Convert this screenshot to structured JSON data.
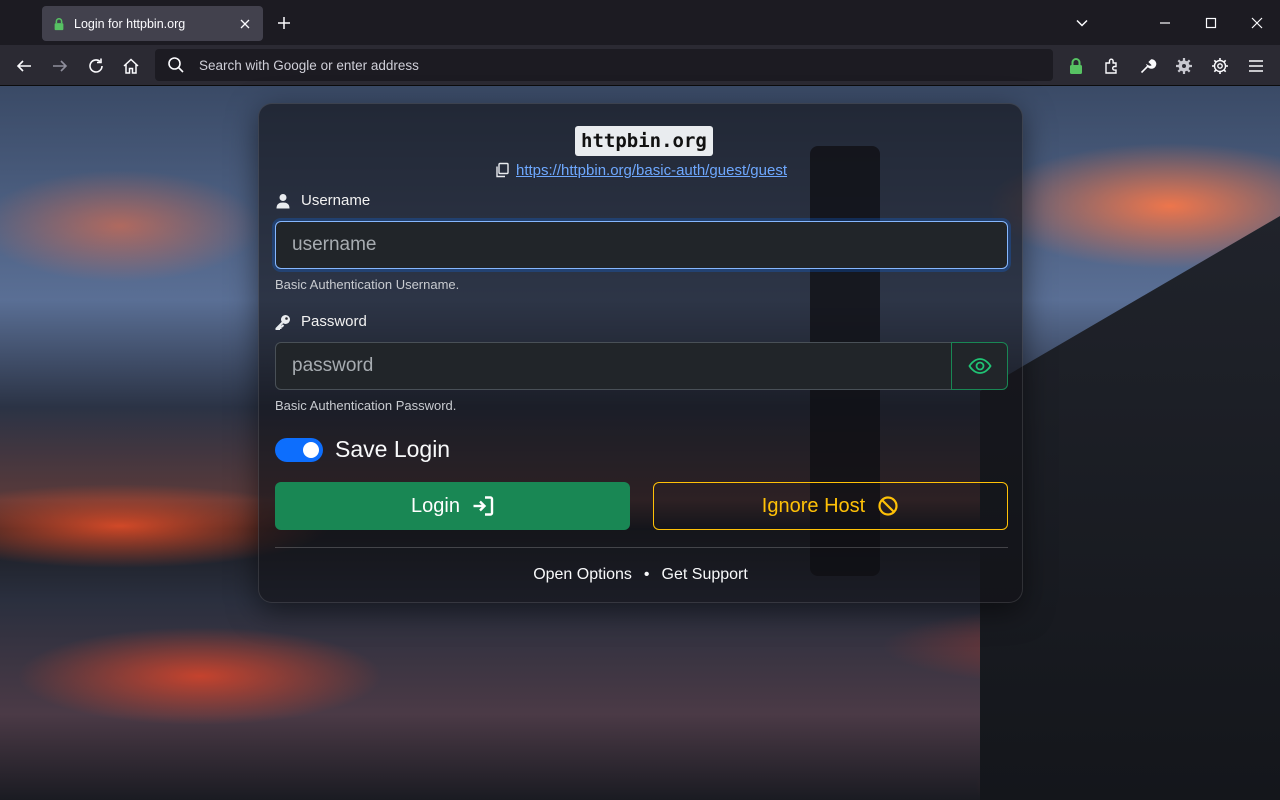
{
  "browser": {
    "tab_title": "Login for httpbin.org",
    "url_placeholder": "Search with Google or enter address",
    "colors": {
      "lock_green": "#3fe1b0",
      "tab_bg": "#42414d",
      "toolbar_bg": "#2b2a33"
    }
  },
  "dialog": {
    "host": "httpbin.org",
    "url": "https://httpbin.org/basic-auth/guest/guest",
    "username": {
      "label": "Username",
      "placeholder": "username",
      "value": "",
      "help": "Basic Authentication Username."
    },
    "password": {
      "label": "Password",
      "placeholder": "password",
      "value": "",
      "help": "Basic Authentication Password."
    },
    "save_login": {
      "label": "Save Login",
      "checked": true
    },
    "login_button": "Login",
    "ignore_button": "Ignore Host",
    "footer": {
      "open_options": "Open Options",
      "separator": "•",
      "get_support": "Get Support"
    },
    "colors": {
      "login": "#198754",
      "ignore": "#ffc107",
      "toggle": "#0d6efd",
      "link": "#6ea8fe"
    }
  }
}
